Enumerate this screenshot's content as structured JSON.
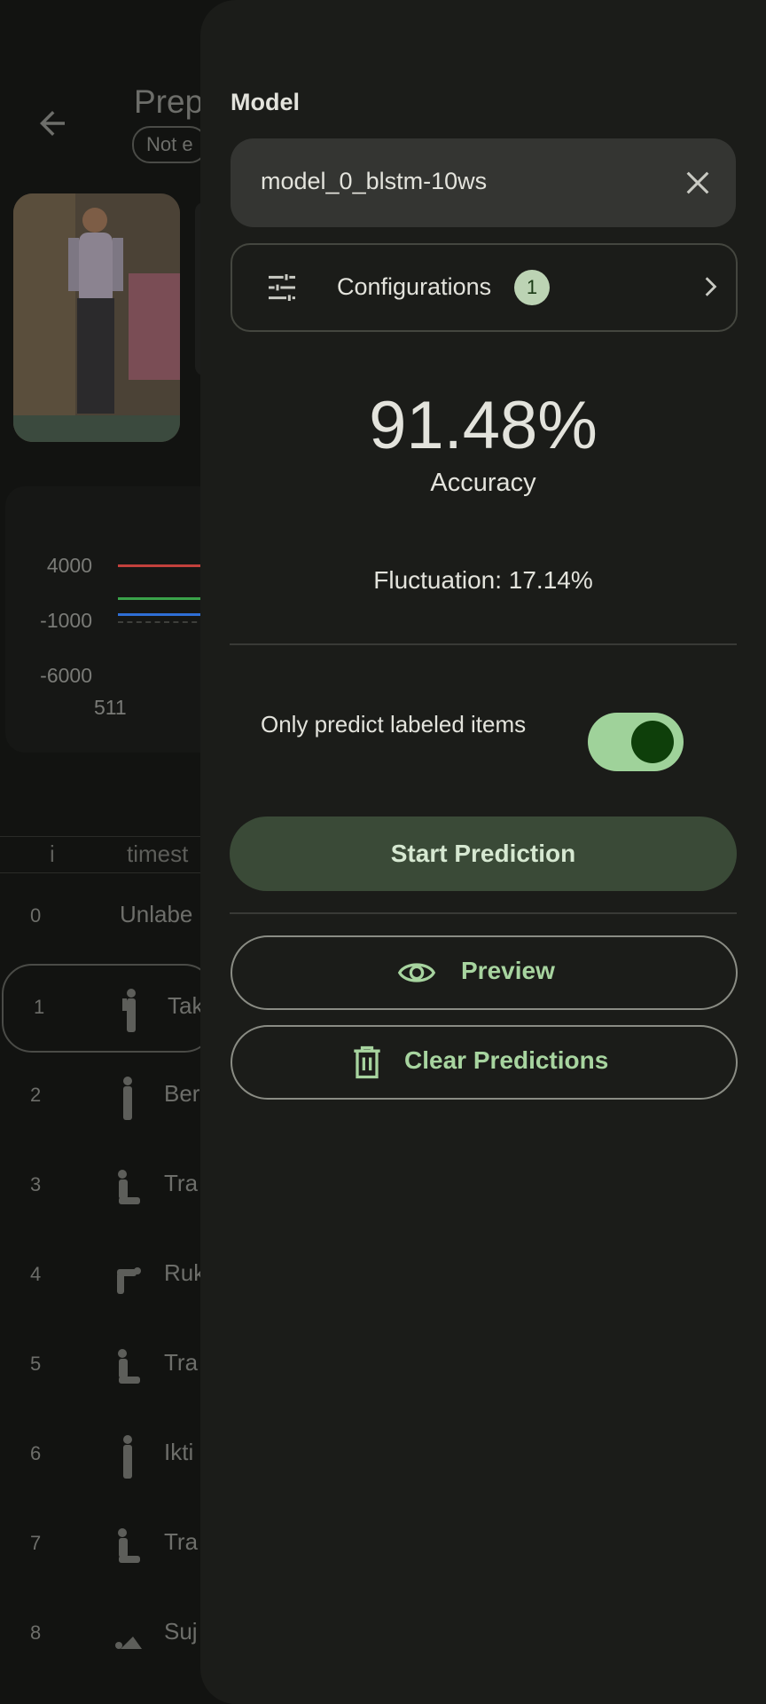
{
  "background": {
    "title": "Prep",
    "status_chip": "Not e",
    "chart": {
      "y_ticks": [
        "4000",
        "-1000",
        "-6000"
      ],
      "x_ticks": [
        "511"
      ],
      "series_colors": [
        "#c2413c",
        "#3aa34a",
        "#2f6fd6"
      ]
    },
    "table": {
      "columns": [
        "i",
        "timest"
      ],
      "rows": [
        {
          "index": "0",
          "label": "Unlabe",
          "pose": ""
        },
        {
          "index": "1",
          "label": "Tak",
          "pose": "standing-hands-up"
        },
        {
          "index": "2",
          "label": "Ber",
          "pose": "standing"
        },
        {
          "index": "3",
          "label": "Tra",
          "pose": "sitting"
        },
        {
          "index": "4",
          "label": "Ruk",
          "pose": "bowing"
        },
        {
          "index": "5",
          "label": "Tra",
          "pose": "sitting"
        },
        {
          "index": "6",
          "label": "Ikti",
          "pose": "standing"
        },
        {
          "index": "7",
          "label": "Tra",
          "pose": "sitting"
        },
        {
          "index": "8",
          "label": "Suj",
          "pose": "prostrating"
        }
      ]
    }
  },
  "sheet": {
    "model_section_title": "Model",
    "model_name": "model_0_blstm-10ws",
    "configurations_label": "Configurations",
    "configurations_badge": "1",
    "accuracy_value": "91.48%",
    "accuracy_label": "Accuracy",
    "fluctuation_text": "Fluctuation: 17.14%",
    "only_labeled_text": "Only predict labeled items",
    "only_labeled_enabled": true,
    "start_button": "Start Prediction",
    "preview_button": "Preview",
    "clear_button": "Clear Predictions"
  },
  "colors": {
    "accent": "#a7d49f",
    "switch_track": "#9fd29a",
    "switch_knob": "#0e3f0a",
    "sheet_bg": "#1b1c19"
  }
}
